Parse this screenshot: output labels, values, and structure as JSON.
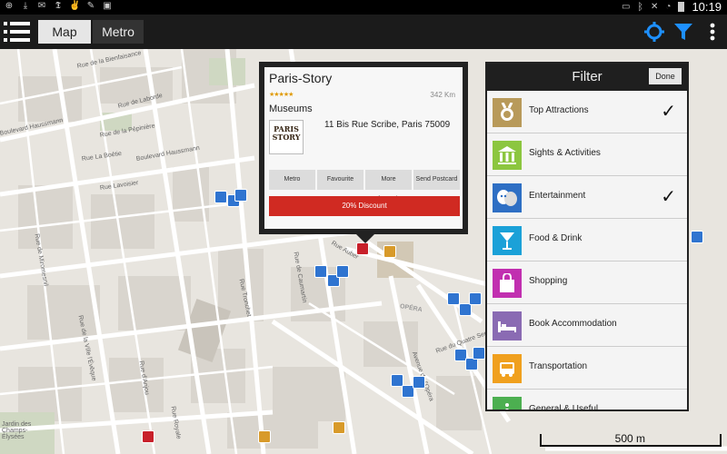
{
  "statusbar": {
    "clock": "10:19",
    "left_icons": [
      "location-icon",
      "download-icon",
      "gmail-icon",
      "news-icon",
      "thumbs-icon",
      "pen-icon",
      "image-icon"
    ],
    "right_icons": [
      "battery-saver-icon",
      "bluetooth-icon",
      "mute-icon",
      "wifi-icon",
      "battery-icon"
    ]
  },
  "appbar": {
    "tabs": [
      {
        "label": "Map",
        "active": true
      },
      {
        "label": "Metro",
        "active": false
      }
    ],
    "icons": [
      "locate-icon",
      "filter-icon",
      "overflow-menu-icon"
    ],
    "accent_color": "#1e90ff"
  },
  "map": {
    "streets": [
      "Rue de la Bienfaisance",
      "Rue de Laborde",
      "Boulevard Haussmann",
      "Rue de la Pépinière",
      "Rue La Boétie",
      "Boulevard Haussmann",
      "Rue Lavoisier",
      "Rue Tronchet",
      "Rue de la Ville l'Évêque",
      "Rue de Miromesnil",
      "Rue d'Anjou",
      "Rue Royale",
      "Rue de Caumartin",
      "Rue Auber",
      "Rue du Quatre Septembre",
      "Avenue de l'Opéra",
      "Jardin des Champs-Élysées",
      "OPÉRA"
    ],
    "scale_label": "500 m"
  },
  "popup": {
    "title": "Paris-Story",
    "stars": "★★★★★",
    "rating": 4,
    "distance": "342 Km",
    "category": "Museums",
    "logo_text": "PARIS STORY",
    "address": "11 Bis Rue Scribe, Paris 75009",
    "actions": [
      "Metro",
      "Favourite",
      "More Information",
      "Send Postcard"
    ],
    "discount": "20% Discount"
  },
  "filter": {
    "title": "Filter",
    "done": "Done",
    "items": [
      {
        "label": "Top Attractions",
        "icon": "medal-icon",
        "color": "#b89a5a",
        "checked": true
      },
      {
        "label": "Sights & Activities",
        "icon": "museum-icon",
        "color": "#8cc63f",
        "checked": false
      },
      {
        "label": "Entertainment",
        "icon": "theatre-masks-icon",
        "color": "#2e6fc4",
        "checked": true
      },
      {
        "label": "Food & Drink",
        "icon": "drink-icon",
        "color": "#1ba1d8",
        "checked": false
      },
      {
        "label": "Shopping",
        "icon": "shopping-bag-icon",
        "color": "#c12fb0",
        "checked": false
      },
      {
        "label": "Book Accommodation",
        "icon": "bed-icon",
        "color": "#8a6bb3",
        "checked": false
      },
      {
        "label": "Transportation",
        "icon": "bus-icon",
        "color": "#f0a01e",
        "checked": false
      },
      {
        "label": "General & Useful",
        "icon": "info-icon",
        "color": "#4caf50",
        "checked": false
      }
    ],
    "check_mark": "✓"
  }
}
